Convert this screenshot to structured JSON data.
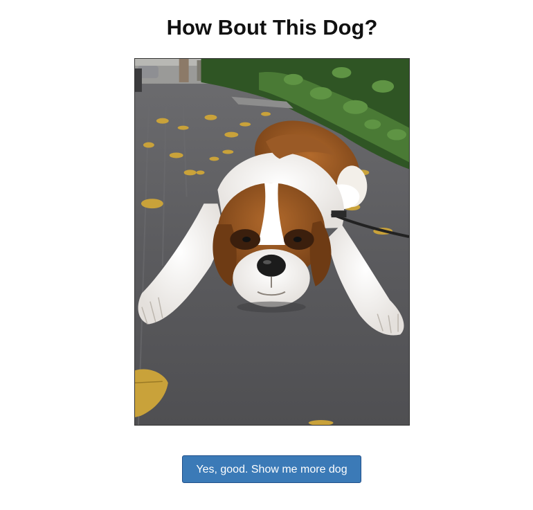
{
  "page": {
    "title": "How Bout This Dog?"
  },
  "photo": {
    "subject_icon": "dog-photo",
    "accent_brown": "#9a5a26",
    "asphalt": "#5a5a5c",
    "hedge_green": "#3f6b2e",
    "leaf_yellow": "#c9a23a"
  },
  "actions": {
    "more_label": "Yes, good. Show me more dog",
    "button_color": "#3b7ab7"
  }
}
